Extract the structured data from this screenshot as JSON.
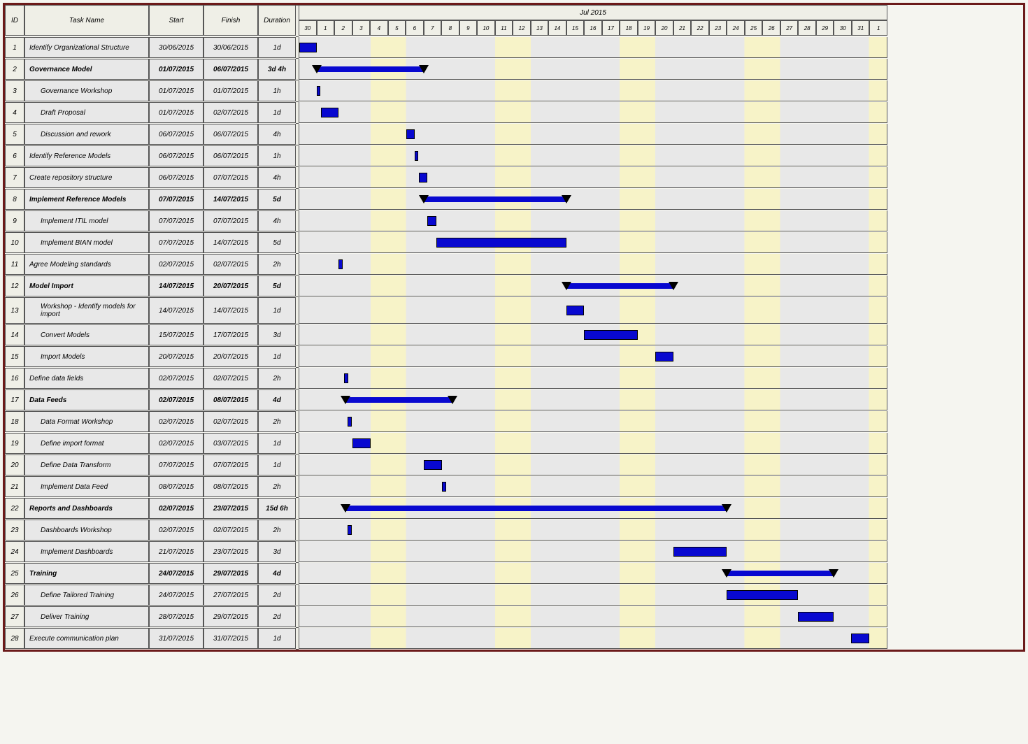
{
  "chart_data": {
    "type": "gantt",
    "title": "Jul 2015",
    "timeline": {
      "unit": "day",
      "days": [
        "30",
        "1",
        "2",
        "3",
        "4",
        "5",
        "6",
        "7",
        "8",
        "9",
        "10",
        "11",
        "12",
        "13",
        "14",
        "15",
        "16",
        "17",
        "18",
        "19",
        "20",
        "21",
        "22",
        "23",
        "24",
        "25",
        "26",
        "27",
        "28",
        "29",
        "30",
        "31",
        "1"
      ],
      "start_index_day": 0,
      "total_cols": 33
    },
    "columns": {
      "id": "ID",
      "name": "Task Name",
      "start": "Start",
      "finish": "Finish",
      "duration": "Duration"
    },
    "tasks": [
      {
        "id": 1,
        "name": "Identify Organizational Structure",
        "start": "30/06/2015",
        "finish": "30/06/2015",
        "duration": "1d",
        "bold": false,
        "indent": 0,
        "type": "task",
        "bar_start": 0,
        "bar_len": 1
      },
      {
        "id": 2,
        "name": "Governance Model",
        "start": "01/07/2015",
        "finish": "06/07/2015",
        "duration": "3d 4h",
        "bold": true,
        "indent": 0,
        "type": "summary",
        "bar_start": 1,
        "bar_len": 6
      },
      {
        "id": 3,
        "name": "Governance Workshop",
        "start": "01/07/2015",
        "finish": "01/07/2015",
        "duration": "1h",
        "bold": false,
        "indent": 1,
        "type": "task",
        "bar_start": 1,
        "bar_len": 0.15
      },
      {
        "id": 4,
        "name": "Draft Proposal",
        "start": "01/07/2015",
        "finish": "02/07/2015",
        "duration": "1d",
        "bold": false,
        "indent": 1,
        "type": "task",
        "bar_start": 1.2,
        "bar_len": 1
      },
      {
        "id": 5,
        "name": "Discussion and rework",
        "start": "06/07/2015",
        "finish": "06/07/2015",
        "duration": "4h",
        "bold": false,
        "indent": 1,
        "type": "task",
        "bar_start": 6,
        "bar_len": 0.5
      },
      {
        "id": 6,
        "name": "Identify Reference Models",
        "start": "06/07/2015",
        "finish": "06/07/2015",
        "duration": "1h",
        "bold": false,
        "indent": 0,
        "type": "task",
        "bar_start": 6.5,
        "bar_len": 0.15
      },
      {
        "id": 7,
        "name": "Create repository structure",
        "start": "06/07/2015",
        "finish": "07/07/2015",
        "duration": "4h",
        "bold": false,
        "indent": 0,
        "type": "task",
        "bar_start": 6.7,
        "bar_len": 0.5
      },
      {
        "id": 8,
        "name": "Implement Reference Models",
        "start": "07/07/2015",
        "finish": "14/07/2015",
        "duration": "5d",
        "bold": true,
        "indent": 0,
        "type": "summary",
        "bar_start": 7,
        "bar_len": 8
      },
      {
        "id": 9,
        "name": "Implement ITIL model",
        "start": "07/07/2015",
        "finish": "07/07/2015",
        "duration": "4h",
        "bold": false,
        "indent": 1,
        "type": "task",
        "bar_start": 7.2,
        "bar_len": 0.5
      },
      {
        "id": 10,
        "name": "Implement BIAN model",
        "start": "07/07/2015",
        "finish": "14/07/2015",
        "duration": "5d",
        "bold": false,
        "indent": 1,
        "type": "task",
        "bar_start": 7.7,
        "bar_len": 7.3
      },
      {
        "id": 11,
        "name": "Agree Modeling standards",
        "start": "02/07/2015",
        "finish": "02/07/2015",
        "duration": "2h",
        "bold": false,
        "indent": 0,
        "type": "task",
        "bar_start": 2.2,
        "bar_len": 0.25
      },
      {
        "id": 12,
        "name": "Model Import",
        "start": "14/07/2015",
        "finish": "20/07/2015",
        "duration": "5d",
        "bold": true,
        "indent": 0,
        "type": "summary",
        "bar_start": 15,
        "bar_len": 6
      },
      {
        "id": 13,
        "name": "Workshop - Identify models for import",
        "start": "14/07/2015",
        "finish": "14/07/2015",
        "duration": "1d",
        "bold": false,
        "indent": 1,
        "type": "task",
        "bar_start": 15,
        "bar_len": 1
      },
      {
        "id": 14,
        "name": "Convert Models",
        "start": "15/07/2015",
        "finish": "17/07/2015",
        "duration": "3d",
        "bold": false,
        "indent": 1,
        "type": "task",
        "bar_start": 16,
        "bar_len": 3
      },
      {
        "id": 15,
        "name": "Import Models",
        "start": "20/07/2015",
        "finish": "20/07/2015",
        "duration": "1d",
        "bold": false,
        "indent": 1,
        "type": "task",
        "bar_start": 20,
        "bar_len": 1
      },
      {
        "id": 16,
        "name": "Define data fields",
        "start": "02/07/2015",
        "finish": "02/07/2015",
        "duration": "2h",
        "bold": false,
        "indent": 0,
        "type": "task",
        "bar_start": 2.5,
        "bar_len": 0.25
      },
      {
        "id": 17,
        "name": "Data Feeds",
        "start": "02/07/2015",
        "finish": "08/07/2015",
        "duration": "4d",
        "bold": true,
        "indent": 0,
        "type": "summary",
        "bar_start": 2.6,
        "bar_len": 6
      },
      {
        "id": 18,
        "name": "Data Format Workshop",
        "start": "02/07/2015",
        "finish": "02/07/2015",
        "duration": "2h",
        "bold": false,
        "indent": 1,
        "type": "task",
        "bar_start": 2.7,
        "bar_len": 0.25
      },
      {
        "id": 19,
        "name": "Define import format",
        "start": "02/07/2015",
        "finish": "03/07/2015",
        "duration": "1d",
        "bold": false,
        "indent": 1,
        "type": "task",
        "bar_start": 3,
        "bar_len": 1
      },
      {
        "id": 20,
        "name": "Define Data Transform",
        "start": "07/07/2015",
        "finish": "07/07/2015",
        "duration": "1d",
        "bold": false,
        "indent": 1,
        "type": "task",
        "bar_start": 7,
        "bar_len": 1
      },
      {
        "id": 21,
        "name": "Implement Data Feed",
        "start": "08/07/2015",
        "finish": "08/07/2015",
        "duration": "2h",
        "bold": false,
        "indent": 1,
        "type": "task",
        "bar_start": 8,
        "bar_len": 0.25
      },
      {
        "id": 22,
        "name": "Reports and Dashboards",
        "start": "02/07/2015",
        "finish": "23/07/2015",
        "duration": "15d 6h",
        "bold": true,
        "indent": 0,
        "type": "summary",
        "bar_start": 2.6,
        "bar_len": 21.4
      },
      {
        "id": 23,
        "name": "Dashboards Workshop",
        "start": "02/07/2015",
        "finish": "02/07/2015",
        "duration": "2h",
        "bold": false,
        "indent": 1,
        "type": "task",
        "bar_start": 2.7,
        "bar_len": 0.25
      },
      {
        "id": 24,
        "name": "Implement Dashboards",
        "start": "21/07/2015",
        "finish": "23/07/2015",
        "duration": "3d",
        "bold": false,
        "indent": 1,
        "type": "task",
        "bar_start": 21,
        "bar_len": 3
      },
      {
        "id": 25,
        "name": "Training",
        "start": "24/07/2015",
        "finish": "29/07/2015",
        "duration": "4d",
        "bold": true,
        "indent": 0,
        "type": "summary",
        "bar_start": 24,
        "bar_len": 6
      },
      {
        "id": 26,
        "name": "Define Tailored Training",
        "start": "24/07/2015",
        "finish": "27/07/2015",
        "duration": "2d",
        "bold": false,
        "indent": 1,
        "type": "task",
        "bar_start": 24,
        "bar_len": 4
      },
      {
        "id": 27,
        "name": "Deliver Training",
        "start": "28/07/2015",
        "finish": "29/07/2015",
        "duration": "2d",
        "bold": false,
        "indent": 1,
        "type": "task",
        "bar_start": 28,
        "bar_len": 2
      },
      {
        "id": 28,
        "name": "Execute communication plan",
        "start": "31/07/2015",
        "finish": "31/07/2015",
        "duration": "1d",
        "bold": false,
        "indent": 0,
        "type": "task",
        "bar_start": 31,
        "bar_len": 1
      }
    ]
  }
}
